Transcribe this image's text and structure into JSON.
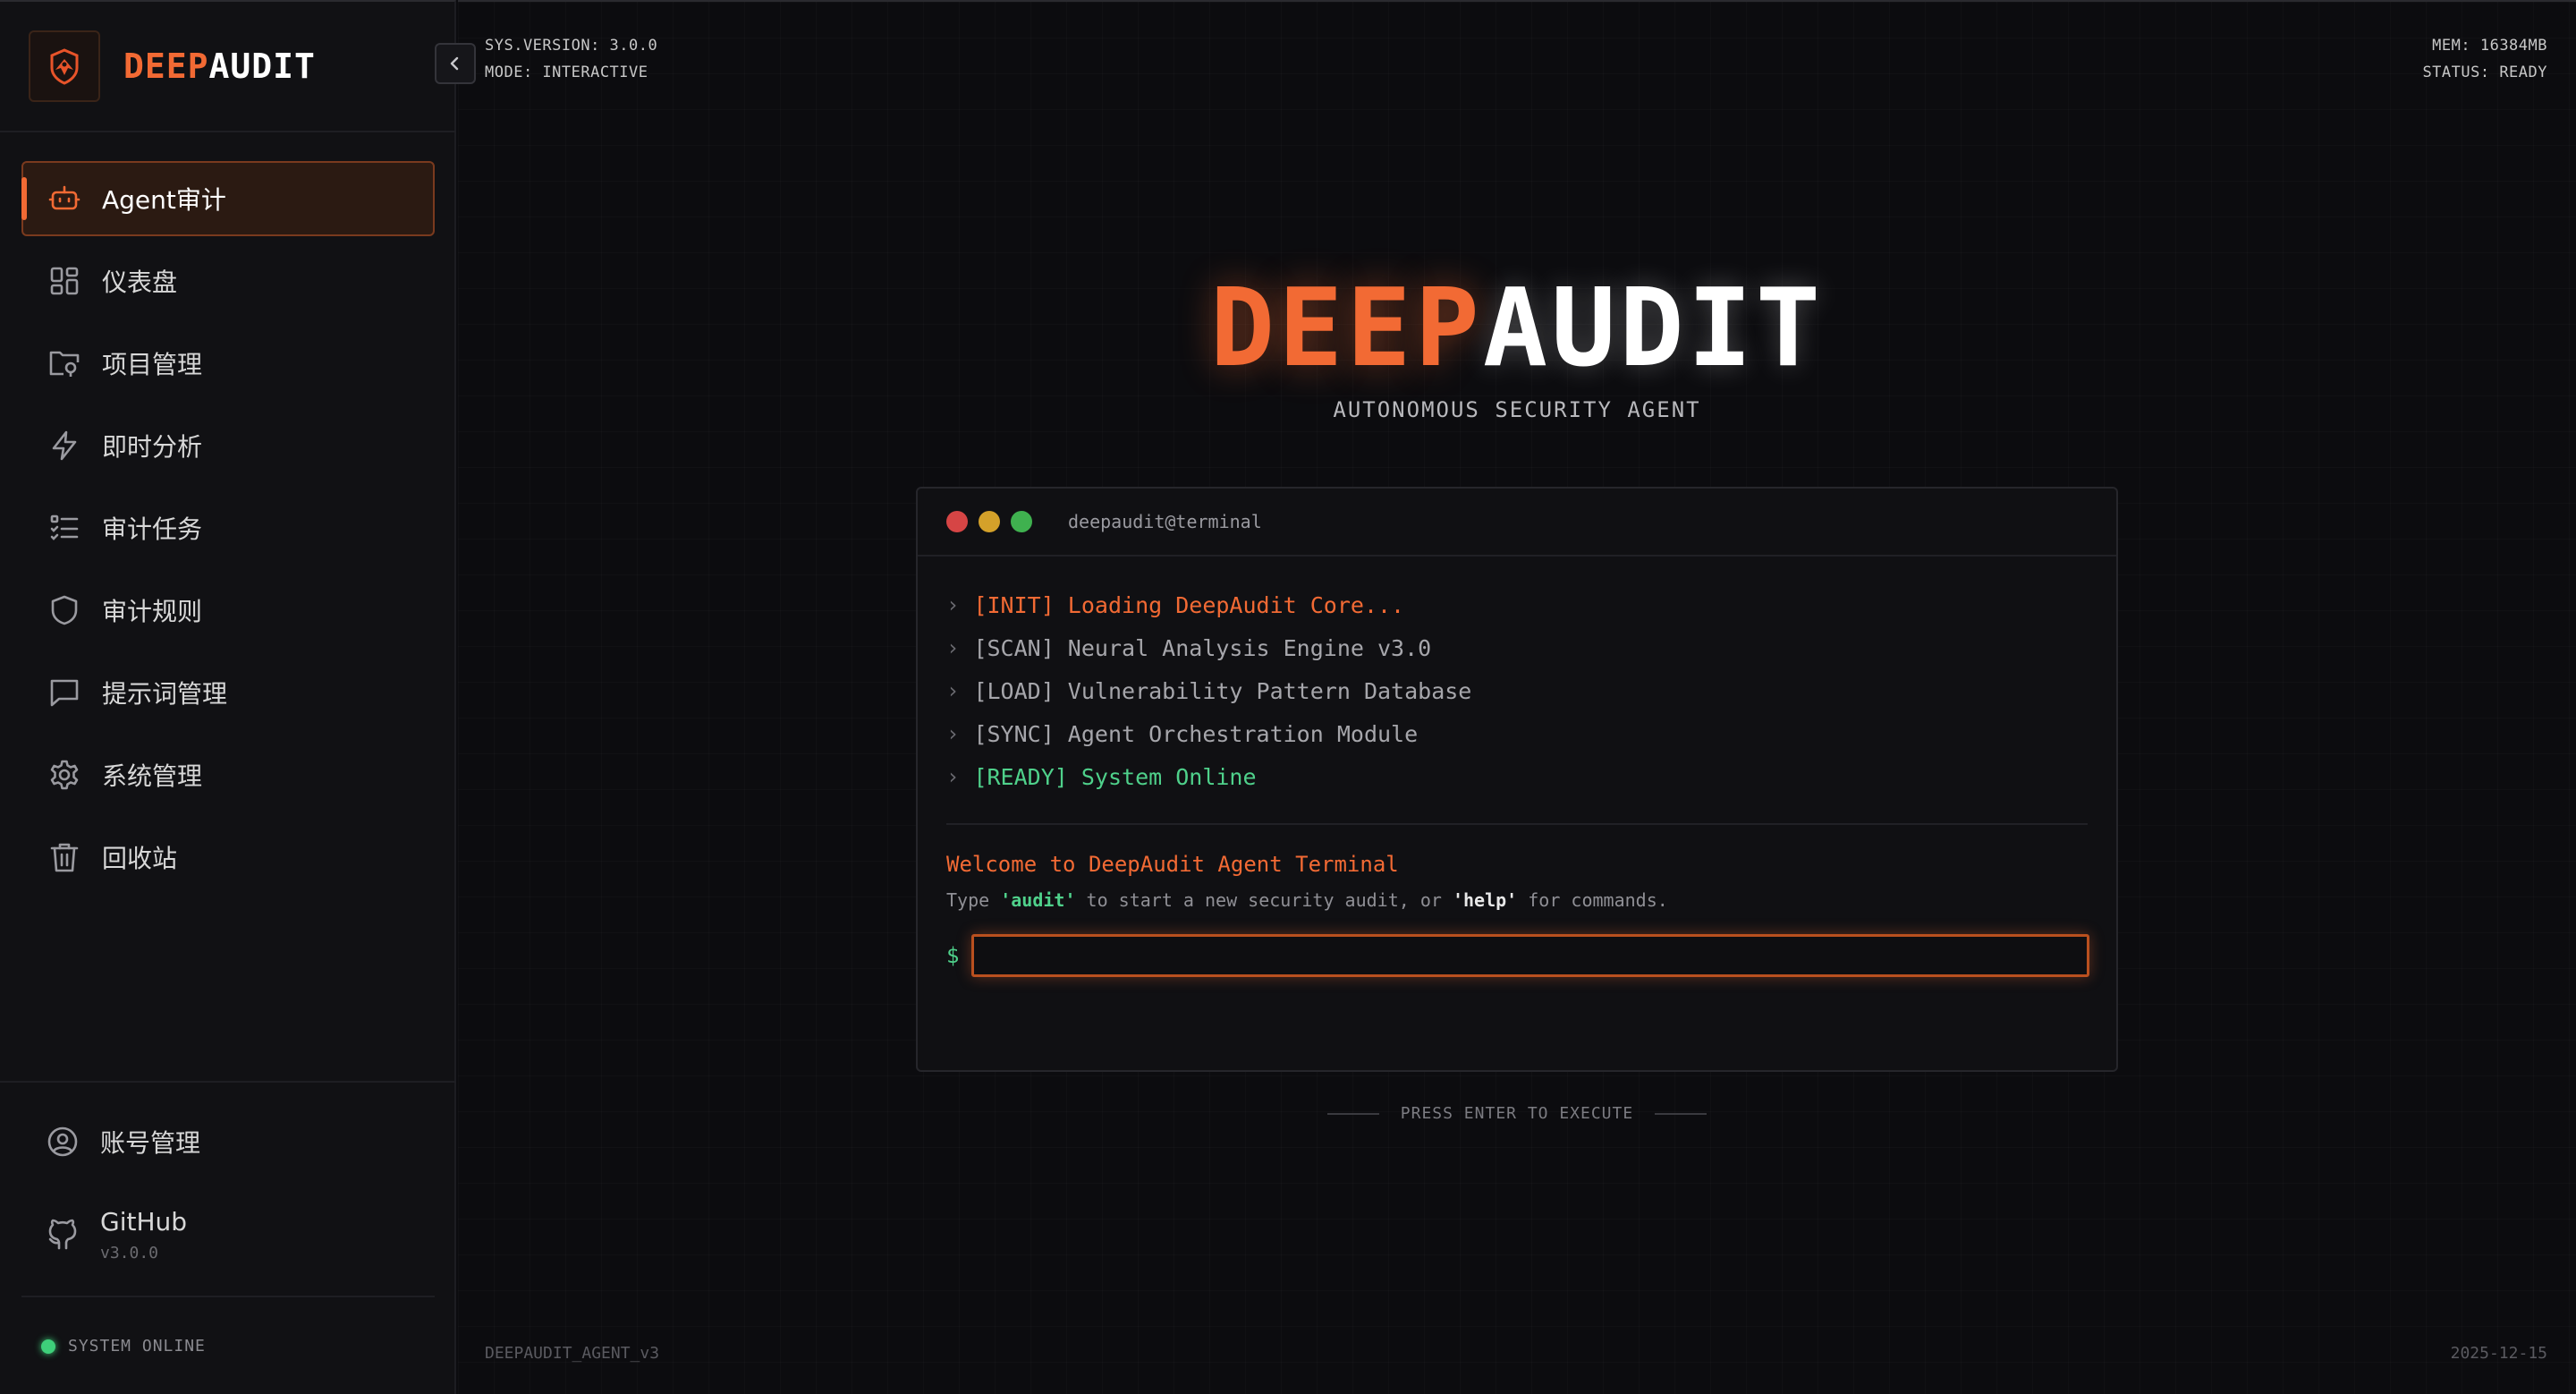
{
  "brand": {
    "name_accent": "DEEP",
    "name_plain": "AUDIT",
    "logo_icon": "bird-shield-icon"
  },
  "sidebar": {
    "collapse_icon": "chevron-left-icon",
    "items": [
      {
        "label": "Agent审计",
        "icon": "robot-icon",
        "active": true
      },
      {
        "label": "仪表盘",
        "icon": "dashboard-grid-icon"
      },
      {
        "label": "项目管理",
        "icon": "folder-icon"
      },
      {
        "label": "即时分析",
        "icon": "lightning-icon"
      },
      {
        "label": "审计任务",
        "icon": "task-list-icon"
      },
      {
        "label": "审计规则",
        "icon": "shield-icon"
      },
      {
        "label": "提示词管理",
        "icon": "chat-icon"
      },
      {
        "label": "系统管理",
        "icon": "gear-icon"
      },
      {
        "label": "回收站",
        "icon": "trash-icon"
      }
    ],
    "account": {
      "label": "账号管理",
      "icon": "user-circle-icon"
    },
    "github": {
      "label": "GitHub",
      "version": "v3.0.0",
      "icon": "github-icon"
    },
    "status": "SYSTEM ONLINE"
  },
  "header": {
    "sys_version": "SYS.VERSION: 3.0.0",
    "mode": "MODE: INTERACTIVE",
    "mem": "MEM: 16384MB",
    "status": "STATUS: READY"
  },
  "hero": {
    "title_accent": "DEEP",
    "title_plain": "AUDIT",
    "subtitle": "AUTONOMOUS SECURITY AGENT"
  },
  "terminal": {
    "title": "deepaudit@terminal",
    "lines": [
      "[INIT] Loading DeepAudit Core...",
      "[SCAN] Neural Analysis Engine v3.0",
      "[LOAD] Vulnerability Pattern Database",
      "[SYNC] Agent Orchestration Module",
      "[READY] System Online"
    ],
    "welcome": "Welcome to DeepAudit Agent Terminal",
    "hint_prefix": "Type ",
    "hint_kw1": "'audit'",
    "hint_mid": " to start a new security audit, or ",
    "hint_kw2": "'help'",
    "hint_suffix": " for commands.",
    "prompt": "$",
    "input_value": "",
    "input_placeholder": ""
  },
  "press_enter": "PRESS ENTER TO EXECUTE",
  "footer": {
    "left": "DEEPAUDIT_AGENT_v3",
    "right": "2025-12-15"
  },
  "colors": {
    "accent": "#f26a34",
    "success": "#4fd18b",
    "background": "#0c0c0f"
  }
}
